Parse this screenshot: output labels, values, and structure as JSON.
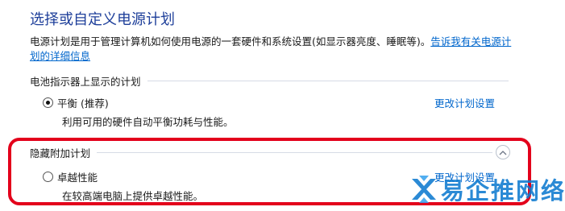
{
  "title": "选择或自定义电源计划",
  "description": {
    "text": "电源计划是用于管理计算机如何使用电源的一套硬件和系统设置(如显示器亮度、睡眠等)。",
    "link": "告诉我有关电源计划的详细信息"
  },
  "battery_section": {
    "header": "电池指示器上显示的计划",
    "plans": [
      {
        "name": "平衡 (推荐)",
        "description": "利用可用的硬件自动平衡功耗与性能。",
        "selected": true,
        "change_link": "更改计划设置"
      }
    ]
  },
  "hidden_section": {
    "header": "隐藏附加计划",
    "expanded": true,
    "collapse_icon": "chevron-up-icon",
    "plans": [
      {
        "name": "卓越性能",
        "description": "在较高端电脑上提供卓越性能。",
        "selected": false,
        "change_link": "更改计划设置"
      }
    ]
  },
  "watermark": {
    "text": "易企推网络",
    "logo_icon": "x-logo-icon"
  },
  "colors": {
    "title": "#1e3f9a",
    "link": "#0066cc",
    "highlight": "#e3001b",
    "watermark": "#0e7ad0",
    "divider": "#d6dbe5"
  }
}
